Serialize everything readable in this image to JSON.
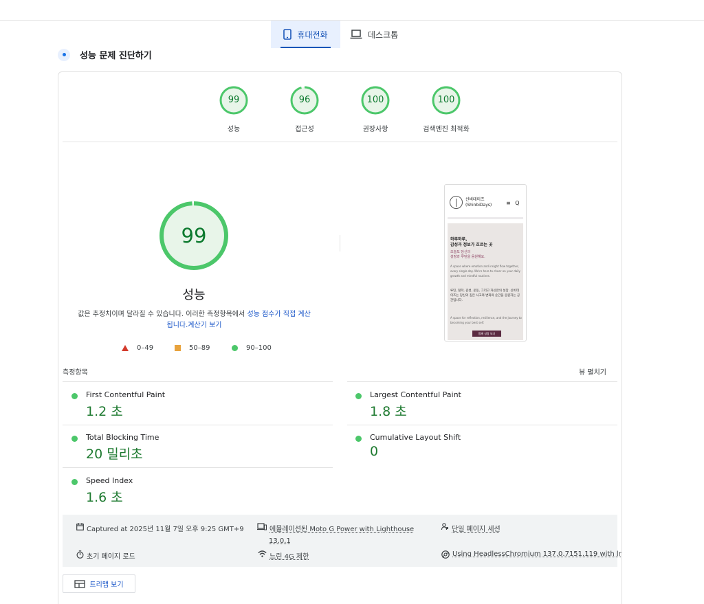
{
  "tabs": {
    "mobile": "휴대전화",
    "desktop": "데스크톱"
  },
  "section_title": "성능 문제 진단하기",
  "scores": [
    {
      "value": "99",
      "label": "성능"
    },
    {
      "value": "96",
      "label": "접근성"
    },
    {
      "value": "100",
      "label": "권장사항"
    },
    {
      "value": "100",
      "label": "검색엔진 최적화"
    }
  ],
  "performance": {
    "score": "99",
    "label": "성능",
    "desc_text": "값은 추정치이며 달라질 수 있습니다. 이러한 측정항목에서",
    "desc_link": "성능 점수가 직접 계산됩니다.",
    "calc_link": "계산기 보기"
  },
  "legend": {
    "bad": "0–49",
    "average": "50–89",
    "good": "90–100"
  },
  "preview": {
    "brand": "신비데이즈",
    "brand_en": "(ShinbiDays)",
    "menu": "≡ Q",
    "headline_1": "하루하루,",
    "headline_2": "감성과 정보가 흐르는 곳",
    "sub_1": "오늘도 당신의",
    "sub_2": "성장과 루틴을 응원해요.",
    "en_text": "A space where emotion and insight flow together, every single day. We're here to cheer on your daily growth and mindful routines.",
    "kr_text": "루틴, 철학, 감성, 운동, 그리고 자신만의 성장. 신비데이즈는 당신의 깊은 사고와 변화의 순간을 응원하는 공간입니다.",
    "en_text_2": "A space for reflection, resilience, and the journey to becoming your best self.",
    "cta": "함께 성장 보기"
  },
  "metrics": {
    "title": "측정항목",
    "expand": "뷰 펼치기",
    "items": [
      {
        "name": "First Contentful Paint",
        "value": "1.2 초"
      },
      {
        "name": "Largest Contentful Paint",
        "value": "1.8 초"
      },
      {
        "name": "Total Blocking Time",
        "value": "20 밀리초"
      },
      {
        "name": "Cumulative Layout Shift",
        "value": "0"
      },
      {
        "name": "Speed Index",
        "value": "1.6 초"
      }
    ]
  },
  "runtime": {
    "captured": "Captured at 2025년 11월 7일 오후 9:25 GMT+9",
    "device_1": "에뮬레이션된 Moto G Power with Lighthouse",
    "device_2": "13.0.1",
    "session": "단일 페이지 세션",
    "load": "초기 페이지 로드",
    "network": "느린 4G 제한",
    "browser": "Using HeadlessChromium 137.0.7151.119 with lr"
  },
  "treemap_button": "트리맵 보기",
  "colors": {
    "pass": "#0c7a2f",
    "pass_ring": "#4cc76a",
    "pass_fill": "#e8f5e9",
    "link": "#1a56c8",
    "tab_active_bg": "#e8f0fe"
  }
}
